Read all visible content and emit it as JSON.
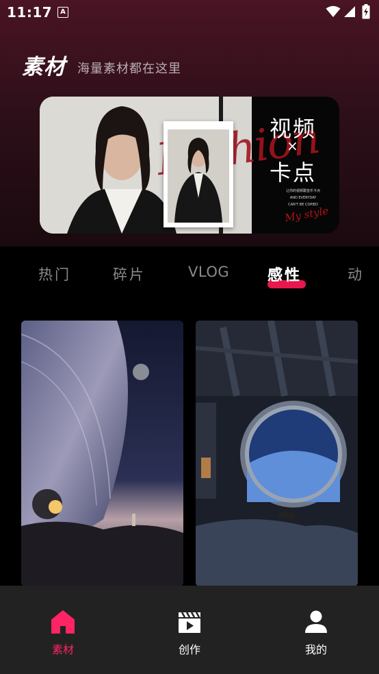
{
  "status": {
    "time": "11:17",
    "notification_icon": "a-icon",
    "icons": [
      "wifi-icon",
      "signal-icon",
      "battery-charging-icon"
    ]
  },
  "header": {
    "title": "素材",
    "subtitle": "海量素材都在这里"
  },
  "banner": {
    "script_text": "Fashion",
    "title_line1": "视频",
    "title_x": "×",
    "title_line2": "卡点",
    "small_text": [
      "让你的视频跟音乐卡点",
      "AND EVERYDAY",
      "CAN'T BE COPIED"
    ],
    "signature": "My style"
  },
  "tabs": {
    "items": [
      "热门",
      "碎片",
      "VLOG",
      "感性",
      "动"
    ],
    "active_index": 3
  },
  "cards": [
    {
      "subject": "planet-landscape"
    },
    {
      "subject": "spaceship-window-cat"
    }
  ],
  "bottom_nav": {
    "items": [
      {
        "label": "素材",
        "icon": "home-icon",
        "active": true
      },
      {
        "label": "创作",
        "icon": "clapperboard-icon",
        "active": false
      },
      {
        "label": "我的",
        "icon": "user-icon",
        "active": false
      }
    ]
  },
  "colors": {
    "accent": "#ff2463",
    "tab_underline": "#e8174e",
    "header_bg": "#4a1424",
    "nav_bg": "#222222"
  }
}
